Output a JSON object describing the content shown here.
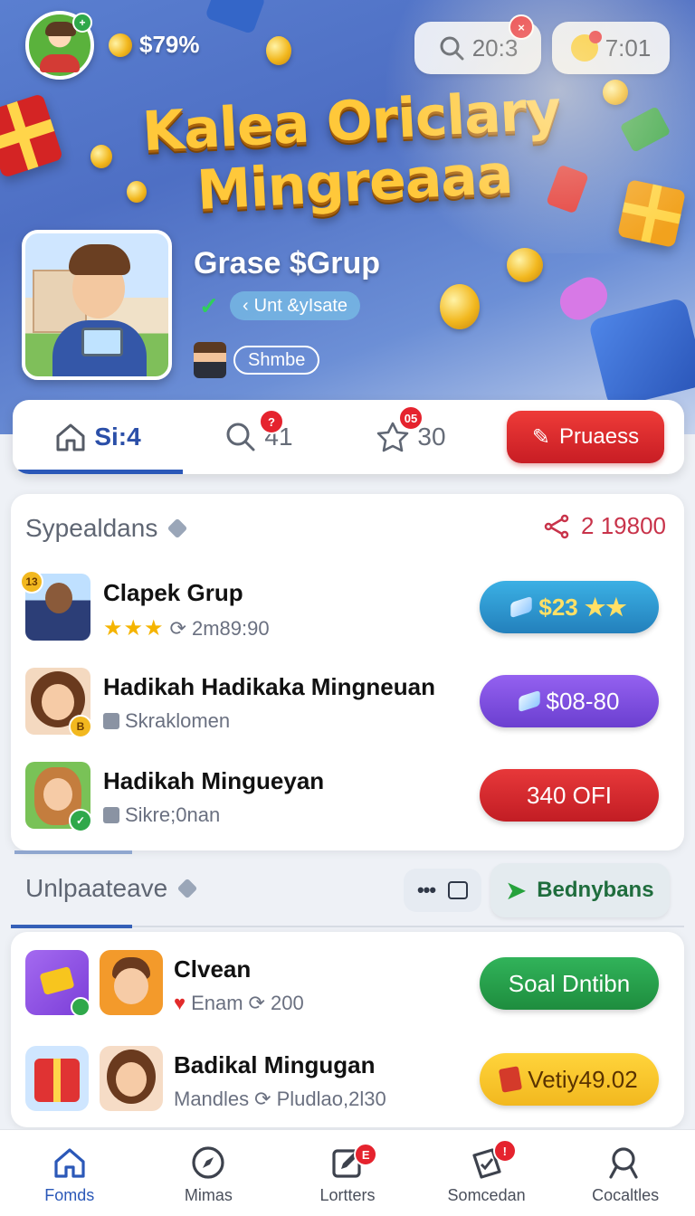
{
  "header": {
    "balance": "$79%",
    "search_value": "20:3",
    "search_badge": "×",
    "time": "7:01",
    "avatar_badge": "+"
  },
  "hero": {
    "title_line1": "Kalea Oriclary",
    "title_line2": "Mingreaaa",
    "group_name": "Grase $Grup",
    "tag_label": "Unt &yIsate",
    "outline_label": "Shmbe"
  },
  "tabs": [
    {
      "label": "Si:4",
      "icon": "home-icon"
    },
    {
      "label": "41",
      "icon": "search-icon",
      "badge": "?"
    },
    {
      "label": "30",
      "icon": "star-outline-icon",
      "badge": "05"
    }
  ],
  "tab_cta": {
    "label": "Pruaess",
    "icon": "pencil-icon"
  },
  "section1": {
    "title": "Sypealdans",
    "share_count": "2 19800",
    "rows": [
      {
        "title": "Clapek Grup",
        "sub_stars": "★★★",
        "sub_meta": "2m89:90",
        "button": "$23 ★★",
        "button_color": "#2f9bd0",
        "badge": "13"
      },
      {
        "title": "Hadikah Hadikaka Mingneuan",
        "sub_meta": "Skraklomen",
        "button": "$08-80",
        "button_color": "#7c4fe0",
        "badge": "B"
      },
      {
        "title": "Hadikah Mingueyan",
        "sub_meta": "Sikre;0nan",
        "button": "340 OFI",
        "button_color": "#d42a2f",
        "badge": "✓"
      }
    ]
  },
  "section2": {
    "title": "Unlpaateave",
    "chip_label": "Bednybans"
  },
  "section3": {
    "rows": [
      {
        "title": "Clvean",
        "sub_label": "Enam",
        "sub_meta": "200",
        "button": "Soal Dntibn",
        "button_color": "#24a24c"
      },
      {
        "title": "Badikal Mingugan",
        "sub_label": "Mandles",
        "sub_meta": "Pludlao,2l30",
        "button": "Vetiy49.02",
        "button_color": "#f2c11f"
      }
    ]
  },
  "bottom_nav": [
    {
      "label": "Fomds",
      "icon": "home-icon",
      "active": true
    },
    {
      "label": "Mimas",
      "icon": "compass-icon",
      "active": false
    },
    {
      "label": "Lortters",
      "icon": "edit-icon",
      "active": false,
      "badge": "E"
    },
    {
      "label": "Somcedan",
      "icon": "ticket-icon",
      "active": false,
      "badge": "!"
    },
    {
      "label": "Cocaltles",
      "icon": "search-icon",
      "active": false
    }
  ],
  "colors": {
    "accent_blue": "#2b58b8",
    "cta_red": "#d42a2f",
    "title_gold": "#ffc83a"
  }
}
